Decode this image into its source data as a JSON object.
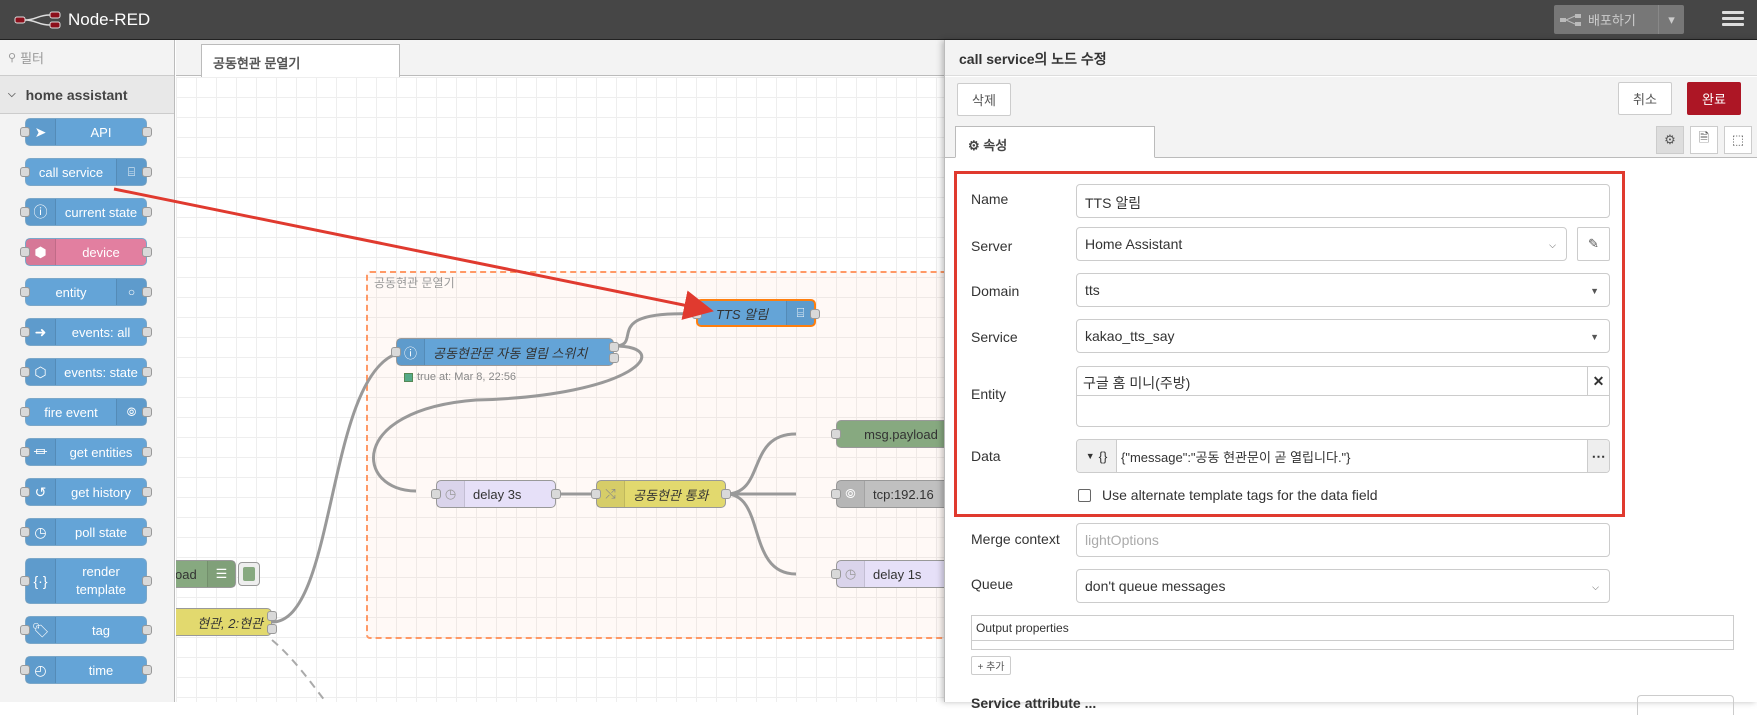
{
  "header": {
    "app_title": "Node-RED",
    "deploy_label": "배포하기",
    "icons": [
      "node-red-logo",
      "deploy-icon",
      "chevron-down-icon",
      "hamburger-menu-icon"
    ]
  },
  "palette": {
    "filter_placeholder": "필터",
    "category": "home assistant",
    "nodes": [
      {
        "label": "API",
        "icon": "paper-plane-icon",
        "color": "#64a4d7"
      },
      {
        "label": "call service",
        "icon": "router-icon",
        "color": "#64a4d7"
      },
      {
        "label": "current state",
        "icon": "info-icon",
        "color": "#64a4d7"
      },
      {
        "label": "device",
        "icon": "cube-icon",
        "color": "#e27fa0"
      },
      {
        "label": "entity",
        "icon": "circle-icon",
        "color": "#64a4d7"
      },
      {
        "label": "events: all",
        "icon": "arrow-right-icon",
        "color": "#64a4d7"
      },
      {
        "label": "events: state",
        "icon": "hexagon-icon",
        "color": "#64a4d7"
      },
      {
        "label": "fire event",
        "icon": "broadcast-icon",
        "color": "#64a4d7"
      },
      {
        "label": "get entities",
        "icon": "filter-icon",
        "color": "#64a4d7"
      },
      {
        "label": "get history",
        "icon": "history-icon",
        "color": "#64a4d7"
      },
      {
        "label": "poll state",
        "icon": "timer-icon",
        "color": "#64a4d7"
      },
      {
        "label": "render template",
        "icon": "braces-icon",
        "color": "#64a4d7"
      },
      {
        "label": "tag",
        "icon": "tag-icon",
        "color": "#64a4d7"
      },
      {
        "label": "time",
        "icon": "clock-icon",
        "color": "#64a4d7"
      }
    ]
  },
  "workspace": {
    "tab_label": "공동현관 문열기",
    "group_label": "공동현관 문열기",
    "nodes": {
      "tts": "TTS 알림",
      "switch": "공동현관문 자동 열림 스위치",
      "switch_status": "true at: Mar 8, 22:56",
      "delay3": "delay 3s",
      "call": "공동현관 통화",
      "msg": "msg.payload",
      "tcp": "tcp:192.16",
      "delay1": "delay 1s",
      "payload_partial": "oad",
      "switch_partial": "현관, 2:현관"
    }
  },
  "tray": {
    "title": "call service의 노드 수정",
    "delete_label": "삭제",
    "cancel_label": "취소",
    "done_label": "완료",
    "tab_label": "속성",
    "form": {
      "name_label": "Name",
      "name_value": "TTS 알림",
      "server_label": "Server",
      "server_value": "Home Assistant",
      "domain_label": "Domain",
      "domain_value": "tts",
      "service_label": "Service",
      "service_value": "kakao_tts_say",
      "entity_label": "Entity",
      "entity_value": "구글 홈 미니(주방)",
      "data_label": "Data",
      "data_type": "{}",
      "data_value": "{\"message\":\"공동 현관문이 곧 열립니다.\"}",
      "alt_tags_label": "Use alternate template tags for the data field",
      "merge_label": "Merge context",
      "merge_placeholder": "lightOptions",
      "queue_label": "Queue",
      "queue_value": "don't queue messages",
      "output_label": "Output properties",
      "add_label": "+ 추가",
      "cutoff_label": "Service attribute ..."
    }
  },
  "colors": {
    "annotation": "#e03a2f",
    "primary": "#ad1625",
    "group_border": "#ff9966"
  }
}
